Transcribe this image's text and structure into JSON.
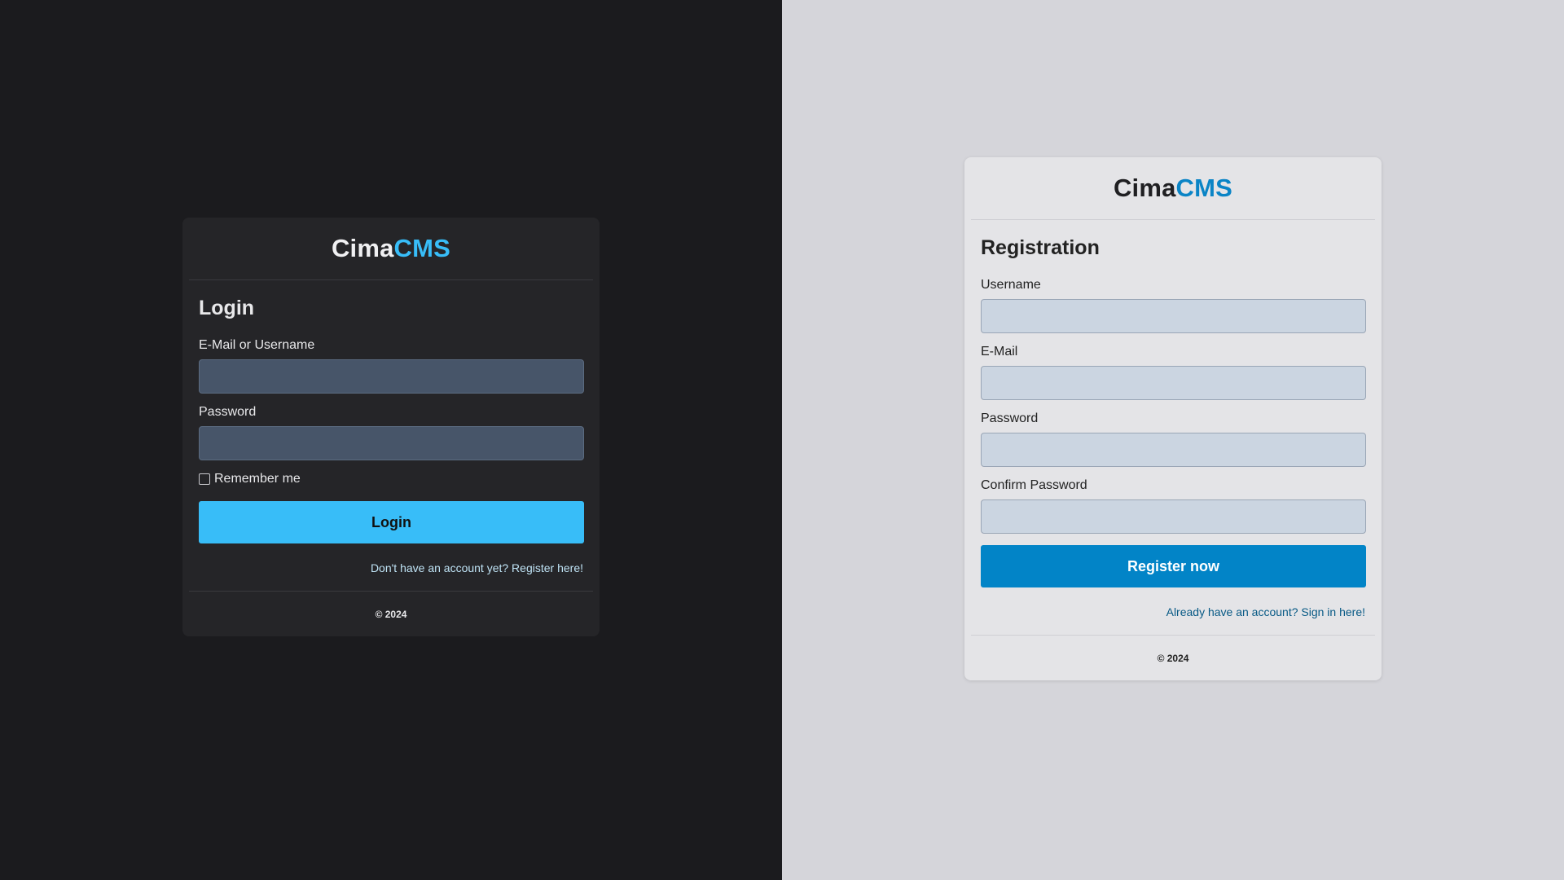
{
  "login": {
    "brand_main": "Cima",
    "brand_accent": "CMS",
    "title": "Login",
    "identity_label": "E-Mail or Username",
    "identity_value": "",
    "password_label": "Password",
    "password_value": "",
    "remember_label": "Remember me",
    "remember_checked": false,
    "submit_label": "Login",
    "switch_link": "Don't have an account yet? Register here!",
    "footer": "© 2024"
  },
  "register": {
    "brand_main": "Cima",
    "brand_accent": "CMS",
    "title": "Registration",
    "username_label": "Username",
    "username_value": "",
    "email_label": "E-Mail",
    "email_value": "",
    "password_label": "Password",
    "password_value": "",
    "confirm_label": "Confirm Password",
    "confirm_value": "",
    "submit_label": "Register now",
    "switch_link": "Already have an account? Sign in here!",
    "footer": "© 2024"
  },
  "colors": {
    "dark_background": "#1b1b1e",
    "dark_card": "#252528",
    "light_background": "#d5d5da",
    "light_card": "#e4e4e7",
    "accent_dark_theme": "#38bdf8",
    "accent_light_theme": "#0284c7"
  }
}
